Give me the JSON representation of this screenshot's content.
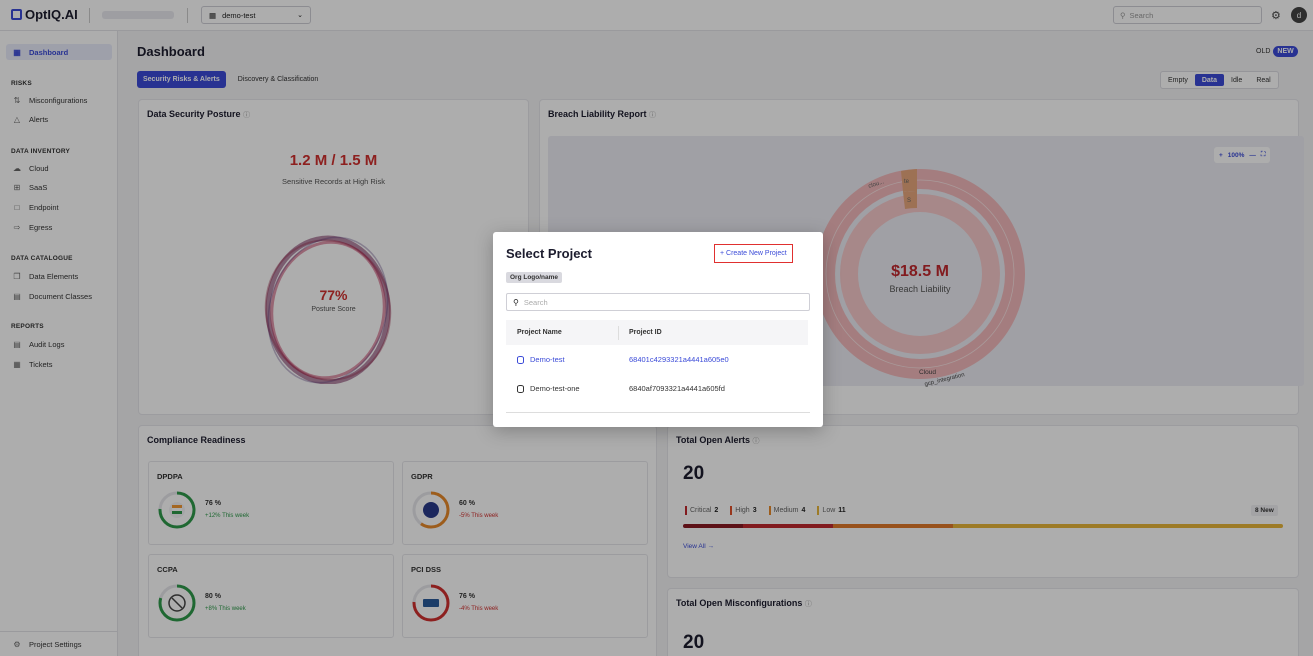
{
  "app": {
    "brand": "OptIQ.AI",
    "project_select": "demo-test",
    "search_placeholder": "Search",
    "avatar": "d"
  },
  "sidebar": {
    "dashboard": "Dashboard",
    "risks_title": "RISKS",
    "risks": [
      "Misconfigurations",
      "Alerts"
    ],
    "inventory_title": "DATA INVENTORY",
    "inventory": [
      "Cloud",
      "SaaS",
      "Endpoint",
      "Egress"
    ],
    "catalogue_title": "DATA CATALOGUE",
    "catalogue": [
      "Data Elements",
      "Document Classes"
    ],
    "reports_title": "REPORTS",
    "reports": [
      "Audit Logs",
      "Tickets"
    ],
    "settings": "Project Settings"
  },
  "main": {
    "title": "Dashboard",
    "old": "OLD",
    "new": "NEW",
    "tabs": [
      "Security Risks & Alerts",
      "Discovery & Classification"
    ],
    "segments": [
      "Empty",
      "Data",
      "Idle",
      "Real"
    ]
  },
  "posture": {
    "title": "Data Security Posture",
    "records": "1.2 M / 1.5 M",
    "records_label": "Sensitive Records at High Risk",
    "score": "77%",
    "score_label": "Posture Score"
  },
  "breach": {
    "title": "Breach Liability Report",
    "zoom": "100%",
    "value": "$18.5 M",
    "label": "Breach Liability",
    "labels": {
      "cloud": "Cloud",
      "gcp": "gcp_integration",
      "clou": "clou...",
      "te": "te",
      "s": "S"
    }
  },
  "compliance": {
    "title": "Compliance Readiness",
    "items": [
      {
        "name": "DPDPA",
        "pct": "76 %",
        "trend": "+12% This week",
        "value": 76
      },
      {
        "name": "GDPR",
        "pct": "60 %",
        "trend": "-5% This week",
        "value": 60
      },
      {
        "name": "CCPA",
        "pct": "80 %",
        "trend": "+8% This week",
        "value": 80
      },
      {
        "name": "PCI DSS",
        "pct": "76 %",
        "trend": "-4% This week",
        "value": 76
      }
    ]
  },
  "alerts": {
    "title": "Total Open Alerts",
    "count": "20",
    "sev": [
      {
        "label": "Critical",
        "count": "2",
        "color": "#c0282e"
      },
      {
        "label": "High",
        "count": "3",
        "color": "#e0502a"
      },
      {
        "label": "Medium",
        "count": "4",
        "color": "#e88a2a"
      },
      {
        "label": "Low",
        "count": "11",
        "color": "#e8b53a"
      }
    ],
    "new_badge": "8 New",
    "view_all": "View All →"
  },
  "misconfig": {
    "title": "Total Open Misconfigurations",
    "count": "20"
  },
  "modal": {
    "title": "Select Project",
    "create": "+ Create New Project",
    "org": "Org Logo/name",
    "search_placeholder": "Search",
    "col_name": "Project Name",
    "col_id": "Project ID",
    "rows": [
      {
        "name": "Demo-test",
        "id": "68401c4293321a4441a605e0"
      },
      {
        "name": "Demo-test-one",
        "id": "6840af7093321a4441a605fd"
      }
    ]
  },
  "colors": {
    "accent": "#3b4bd8",
    "danger": "#d0302f",
    "success": "#2e9a4a"
  }
}
